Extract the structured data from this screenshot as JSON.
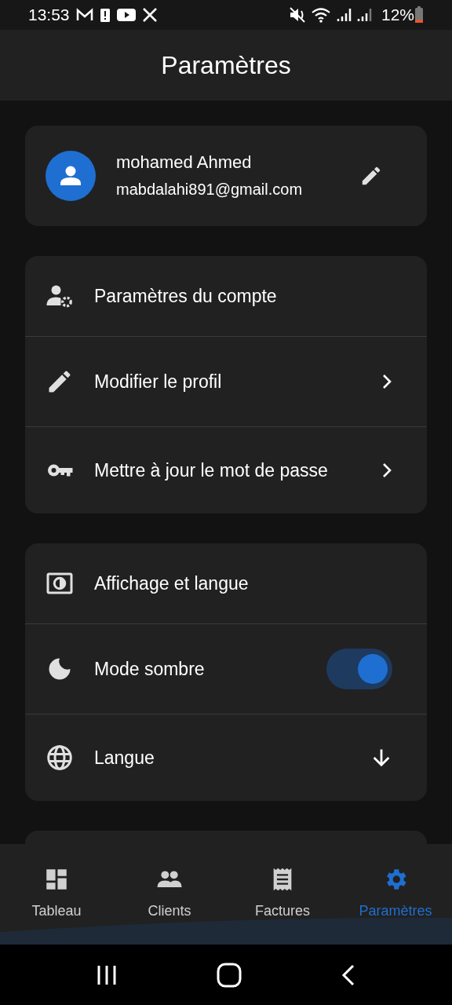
{
  "status_bar": {
    "time": "13:53",
    "battery": "12%"
  },
  "app_bar": {
    "title": "Paramètres"
  },
  "profile": {
    "name": "mohamed Ahmed",
    "email": "mabdalahi891@gmail.com"
  },
  "sections": [
    {
      "header": "Paramètres du compte",
      "items": [
        {
          "label": "Modifier le profil",
          "kind": "link"
        },
        {
          "label": "Mettre à jour le mot de passe",
          "kind": "link"
        }
      ]
    },
    {
      "header": "Affichage et langue",
      "items": [
        {
          "label": "Mode sombre",
          "kind": "toggle",
          "on": true
        },
        {
          "label": "Langue",
          "kind": "dropdown"
        }
      ]
    }
  ],
  "bottom_nav": [
    {
      "label": "Tableau",
      "selected": false
    },
    {
      "label": "Clients",
      "selected": false
    },
    {
      "label": "Factures",
      "selected": false
    },
    {
      "label": "Paramètres",
      "selected": true
    }
  ]
}
